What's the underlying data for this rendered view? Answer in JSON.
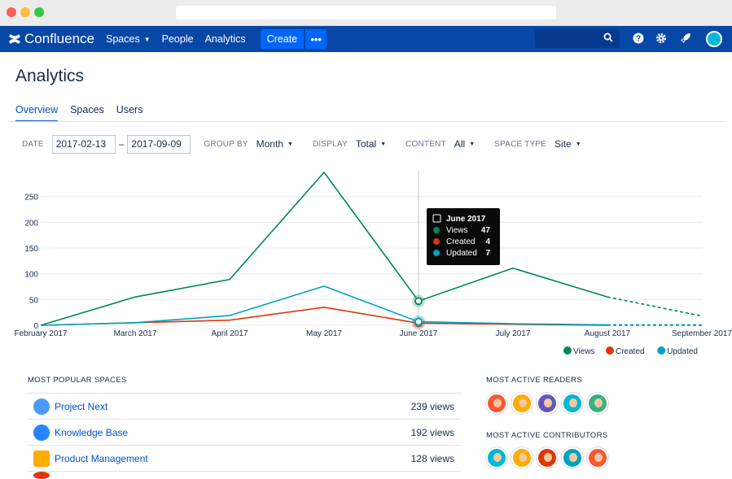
{
  "app": {
    "name": "Confluence",
    "nav": [
      "Spaces",
      "People",
      "Analytics"
    ],
    "create_label": "Create",
    "more_label": "•••",
    "brand_color": "#0747a6"
  },
  "page": {
    "title": "Analytics",
    "tabs": [
      "Overview",
      "Spaces",
      "Users"
    ]
  },
  "filters": {
    "date_label": "DATE",
    "date_from": "2017-02-13",
    "date_sep": "–",
    "date_to": "2017-09-09",
    "group_label": "GROUP BY",
    "group_value": "Month",
    "display_label": "DISPLAY",
    "display_value": "Total",
    "content_label": "CONTENT",
    "content_value": "All",
    "space_type_label": "SPACE TYPE",
    "space_type_value": "Site"
  },
  "chart_data": {
    "type": "line",
    "x": [
      "February 2017",
      "March 2017",
      "April 2017",
      "May 2017",
      "June 2017",
      "July 2017",
      "August 2017",
      "September 2017"
    ],
    "series": [
      {
        "name": "Views",
        "color": "#00875a",
        "values": [
          0,
          55,
          89,
          297,
          47,
          111,
          55,
          18
        ]
      },
      {
        "name": "Created",
        "color": "#de350b",
        "values": [
          0,
          5,
          10,
          35,
          4,
          2,
          0,
          0
        ]
      },
      {
        "name": "Updated",
        "color": "#00a3bf",
        "values": [
          0,
          5,
          19,
          76,
          7,
          3,
          1,
          1
        ]
      }
    ],
    "ylim": [
      0,
      300
    ],
    "yticks": [
      0,
      50,
      100,
      150,
      200,
      250
    ],
    "projected_from_index": 6,
    "legend": "bottom-right",
    "grid": true,
    "tooltip": {
      "title": "June 2017",
      "index": 4,
      "rows": [
        {
          "label": "Views",
          "value": "47",
          "color": "#00875a"
        },
        {
          "label": "Created",
          "value": "4",
          "color": "#de350b"
        },
        {
          "label": "Updated",
          "value": "7",
          "color": "#00a3bf"
        }
      ]
    }
  },
  "popular_spaces": {
    "title": "MOST POPULAR SPACES",
    "items": [
      {
        "name": "Project Next",
        "views": "239 views",
        "color": "#4c9aff"
      },
      {
        "name": "Knowledge Base",
        "views": "192 views",
        "color": "#2684ff"
      },
      {
        "name": "Product Management",
        "views": "128 views",
        "color": "#ffab00"
      }
    ]
  },
  "readers": {
    "title": "MOST ACTIVE READERS",
    "colors": [
      "#ff5630",
      "#ffab00",
      "#6554c0",
      "#00b8d9",
      "#36b37e"
    ]
  },
  "contributors": {
    "title": "MOST ACTIVE CONTRIBUTORS",
    "colors": [
      "#00b8d9",
      "#ffab00",
      "#de350b",
      "#00a3bf",
      "#ff5630"
    ]
  }
}
